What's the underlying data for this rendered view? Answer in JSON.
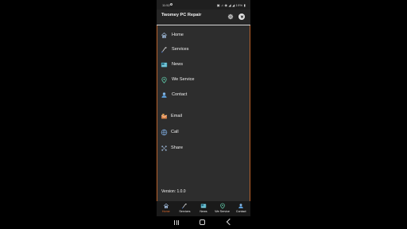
{
  "status_bar": {
    "time": "11:52",
    "indicators": "▣ ♫ ◉ ◢ ◢ 19% ▮",
    "battery_percent": "19%"
  },
  "drawer": {
    "title": "Twomey PC Repair",
    "settings_icon": "gear-icon",
    "close_icon": "close-icon",
    "menu": [
      {
        "label": "Home",
        "icon": "home-icon"
      },
      {
        "label": "Services",
        "icon": "tools-icon"
      },
      {
        "label": "News",
        "icon": "news-icon"
      },
      {
        "label": "We Service",
        "icon": "location-icon"
      },
      {
        "label": "Contact",
        "icon": "contact-icon"
      }
    ],
    "secondary": [
      {
        "label": "Email",
        "icon": "email-icon"
      },
      {
        "label": "Call",
        "icon": "phone-icon"
      },
      {
        "label": "Share",
        "icon": "share-icon"
      }
    ],
    "version": "Version: 1.0.0"
  },
  "tab_bar": {
    "active_index": 0,
    "tabs": [
      {
        "label": "Home",
        "icon": "home-icon"
      },
      {
        "label": "Services",
        "icon": "tools-icon"
      },
      {
        "label": "News",
        "icon": "news-icon"
      },
      {
        "label": "We Service",
        "icon": "location-icon"
      },
      {
        "label": "Contact",
        "icon": "contact-icon"
      }
    ]
  },
  "colors": {
    "accent": "#e06a2b",
    "drawer_background": "#2d2d2d",
    "border": "#b8612c"
  },
  "system_nav": {
    "recents_icon": "recents-icon",
    "home_icon": "nav-home-icon",
    "back_icon": "back-icon"
  }
}
